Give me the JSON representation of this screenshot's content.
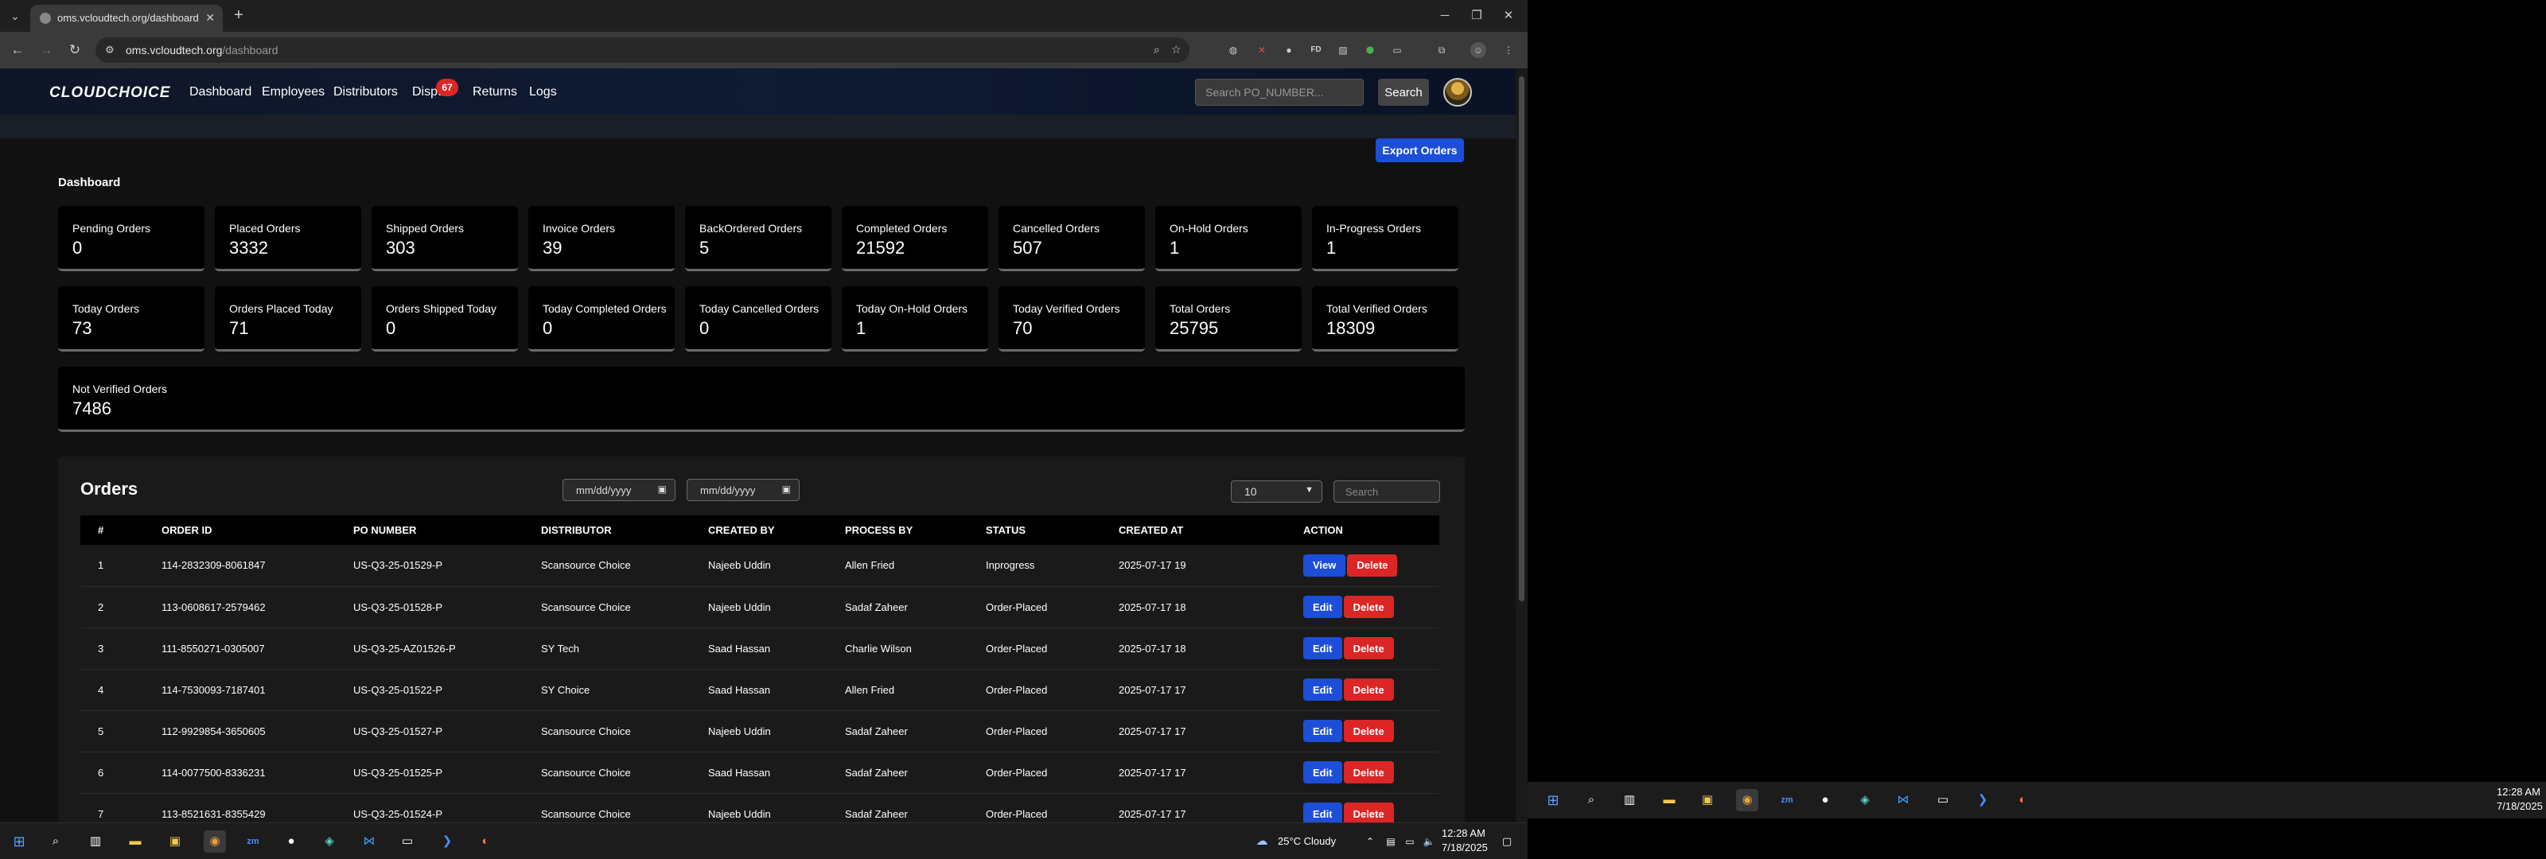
{
  "browser": {
    "tab_title": "oms.vcloudtech.org/dashboard",
    "url_host": "oms.vcloudtech.org",
    "url_path": "/dashboard"
  },
  "app": {
    "brand": "CLOUDCHOICE",
    "nav": [
      "Dashboard",
      "Employees",
      "Distributors",
      "Dispu",
      "Returns",
      "Logs"
    ],
    "disputes_badge": "67",
    "search_placeholder": "Search PO_NUMBER...",
    "search_button": "Search",
    "export_button": "Export Orders",
    "page_title": "Dashboard"
  },
  "stats_row1": [
    {
      "label": "Pending Orders",
      "value": "0"
    },
    {
      "label": "Placed Orders",
      "value": "3332"
    },
    {
      "label": "Shipped Orders",
      "value": "303"
    },
    {
      "label": "Invoice Orders",
      "value": "39"
    },
    {
      "label": "BackOrdered Orders",
      "value": "5"
    },
    {
      "label": "Completed Orders",
      "value": "21592"
    },
    {
      "label": "Cancelled Orders",
      "value": "507"
    },
    {
      "label": "On-Hold Orders",
      "value": "1"
    },
    {
      "label": "In-Progress Orders",
      "value": "1"
    }
  ],
  "stats_row2": [
    {
      "label": "Today Orders",
      "value": "73"
    },
    {
      "label": "Orders Placed Today",
      "value": "71"
    },
    {
      "label": "Orders Shipped Today",
      "value": "0"
    },
    {
      "label": "Today Completed Orders",
      "value": "0"
    },
    {
      "label": "Today Cancelled Orders",
      "value": "0"
    },
    {
      "label": "Today On-Hold Orders",
      "value": "1"
    },
    {
      "label": "Today Verified Orders",
      "value": "70"
    },
    {
      "label": "Total Orders",
      "value": "25795"
    },
    {
      "label": "Total Verified Orders",
      "value": "18309"
    }
  ],
  "stats_row3": {
    "label": "Not Verified Orders",
    "value": "7486"
  },
  "orders": {
    "title": "Orders",
    "date_placeholder": "mm/dd/yyyy",
    "page_size": "10",
    "search_placeholder": "Search",
    "columns": [
      "#",
      "ORDER ID",
      "PO NUMBER",
      "DISTRIBUTOR",
      "CREATED BY",
      "PROCESS BY",
      "STATUS",
      "CREATED AT",
      "ACTION"
    ],
    "rows": [
      [
        "1",
        "114-2832309-8061847",
        "US-Q3-25-01529-P",
        "Scansource Choice",
        "Najeeb Uddin",
        "Allen Fried",
        "Inprogress",
        "2025-07-17 19"
      ],
      [
        "2",
        "113-0608617-2579462",
        "US-Q3-25-01528-P",
        "Scansource Choice",
        "Najeeb Uddin",
        "Sadaf Zaheer",
        "Order-Placed",
        "2025-07-17 18"
      ],
      [
        "3",
        "111-8550271-0305007",
        "US-Q3-25-AZ01526-P",
        "SY Tech",
        "Saad Hassan",
        "Charlie Wilson",
        "Order-Placed",
        "2025-07-17 18"
      ],
      [
        "4",
        "114-7530093-7187401",
        "US-Q3-25-01522-P",
        "SY Choice",
        "Saad Hassan",
        "Allen Fried",
        "Order-Placed",
        "2025-07-17 17"
      ],
      [
        "5",
        "112-9929854-3650605",
        "US-Q3-25-01527-P",
        "Scansource Choice",
        "Najeeb Uddin",
        "Sadaf Zaheer",
        "Order-Placed",
        "2025-07-17 17"
      ],
      [
        "6",
        "114-0077500-8336231",
        "US-Q3-25-01525-P",
        "Scansource Choice",
        "Saad Hassan",
        "Sadaf Zaheer",
        "Order-Placed",
        "2025-07-17 17"
      ],
      [
        "7",
        "113-8521631-8355429",
        "US-Q3-25-01524-P",
        "Scansource Choice",
        "Najeeb Uddin",
        "Sadaf Zaheer",
        "Order-Placed",
        "2025-07-17 17"
      ]
    ],
    "row_actions": [
      "View",
      "Edit",
      "Edit",
      "Edit",
      "Edit",
      "Edit",
      "Edit"
    ],
    "delete_label": "Delete"
  },
  "taskbar": {
    "weather": "25°C  Cloudy",
    "time": "12:28 AM",
    "date": "7/18/2025"
  },
  "taskbar2": {
    "time": "12:28 AM",
    "date": "7/18/2025"
  }
}
